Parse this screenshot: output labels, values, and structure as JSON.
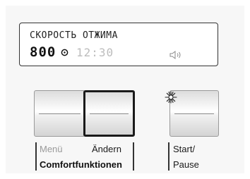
{
  "display": {
    "title": "СКОРОСТЬ ОТЖИМА",
    "spin_speed": "800",
    "time": "12:30",
    "spin_icon": "spin-symbol-icon",
    "sound_icon": "speaker-icon"
  },
  "buttons": {
    "menu_label": "Menü",
    "change_label": "Ändern",
    "group_label": "Comfortfunktionen",
    "start_label": "Start/",
    "pause_label": "Pause",
    "start_indicator_icon": "start-indicator-light-icon"
  },
  "colors": {
    "display_border": "#333333",
    "inactive_text": "#9a9a9a",
    "dim_display_text": "#bdbdbd"
  }
}
